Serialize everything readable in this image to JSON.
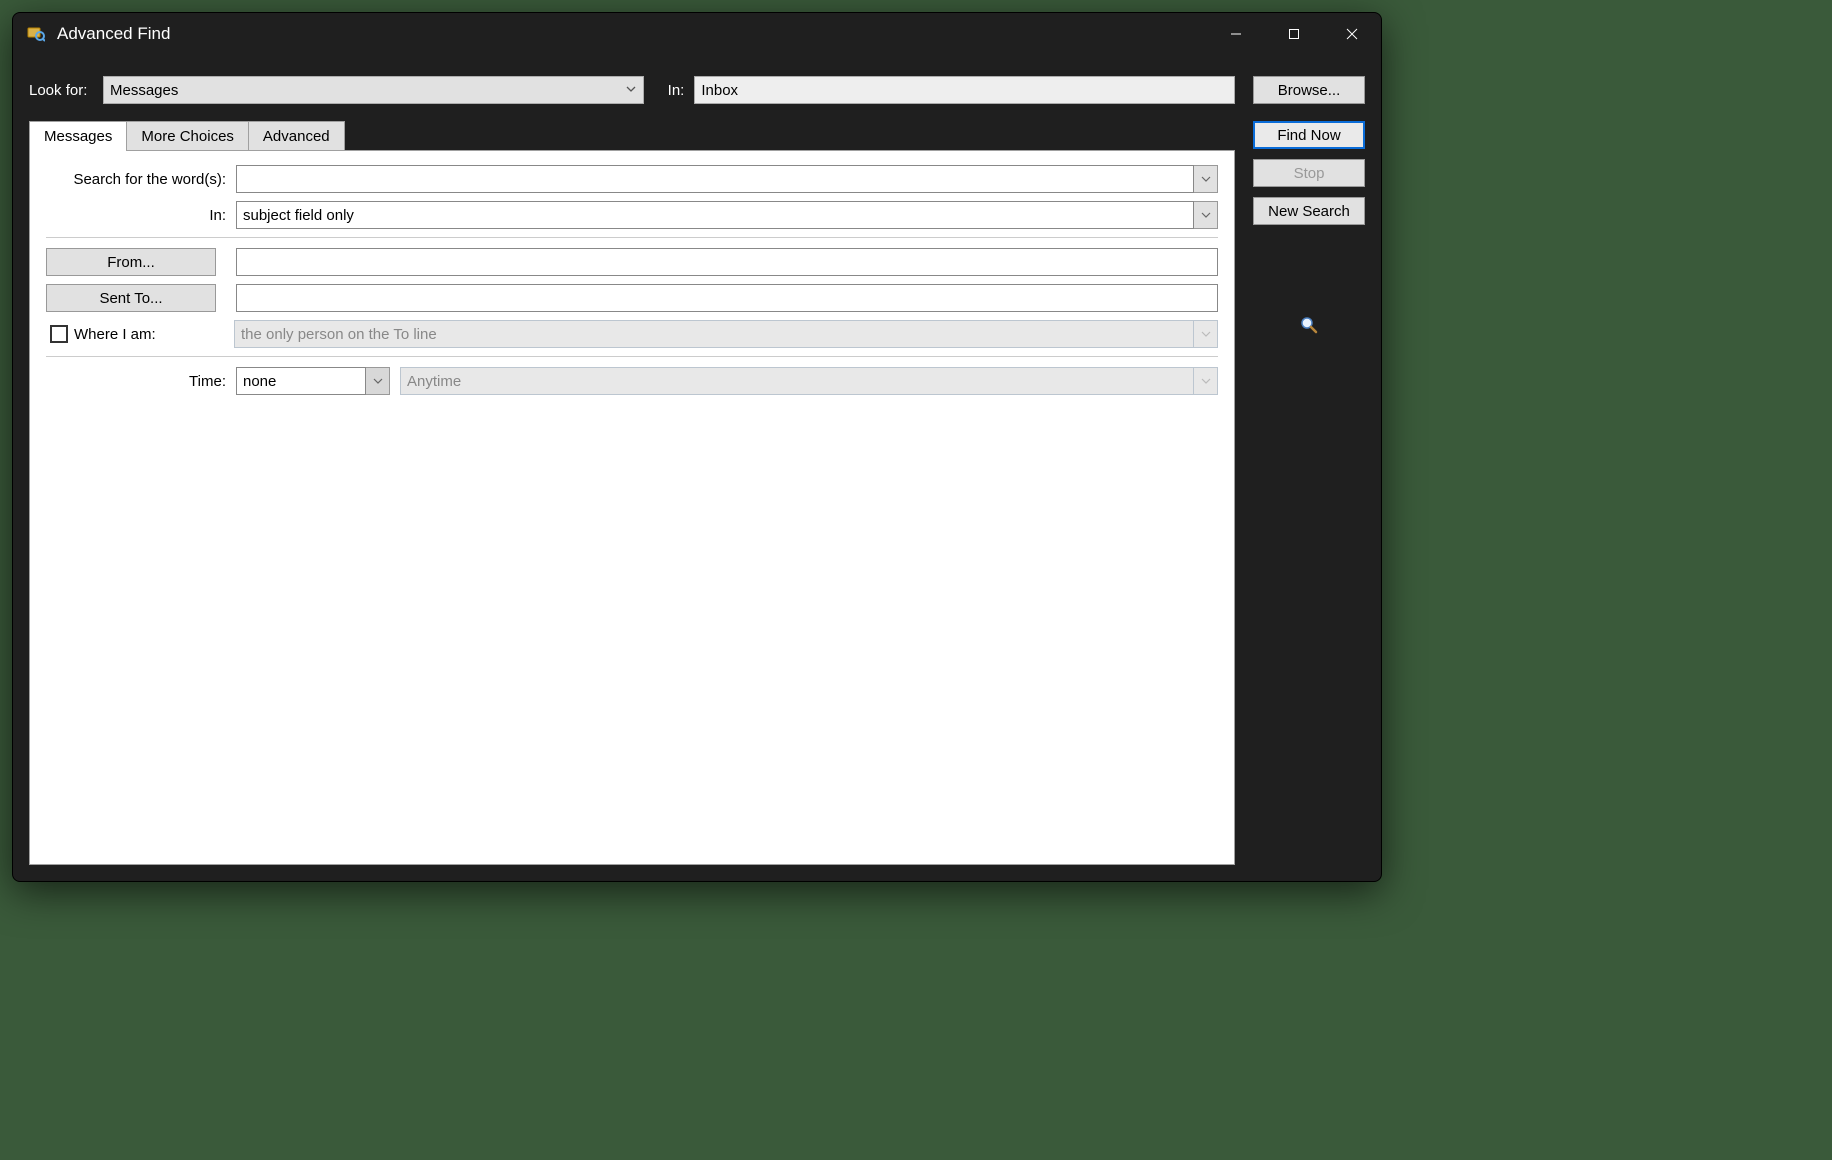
{
  "window": {
    "title": "Advanced Find"
  },
  "header": {
    "look_for_label": "Look for:",
    "look_for_value": "Messages",
    "in_label": "In:",
    "in_value": "Inbox",
    "browse_label": "Browse..."
  },
  "tabs": {
    "messages": "Messages",
    "more_choices": "More Choices",
    "advanced": "Advanced"
  },
  "messages_tab": {
    "search_words_label": "Search for the word(s):",
    "search_words_value": "",
    "in_label": "In:",
    "in_value": "subject field only",
    "from_label": "From...",
    "from_value": "",
    "sent_to_label": "Sent To...",
    "sent_to_value": "",
    "where_i_am_label": "Where I am:",
    "where_i_am_value": "the only person on the To line",
    "time_label": "Time:",
    "time_value": "none",
    "time_range_value": "Anytime"
  },
  "side": {
    "find_now": "Find Now",
    "stop": "Stop",
    "new_search": "New Search"
  }
}
